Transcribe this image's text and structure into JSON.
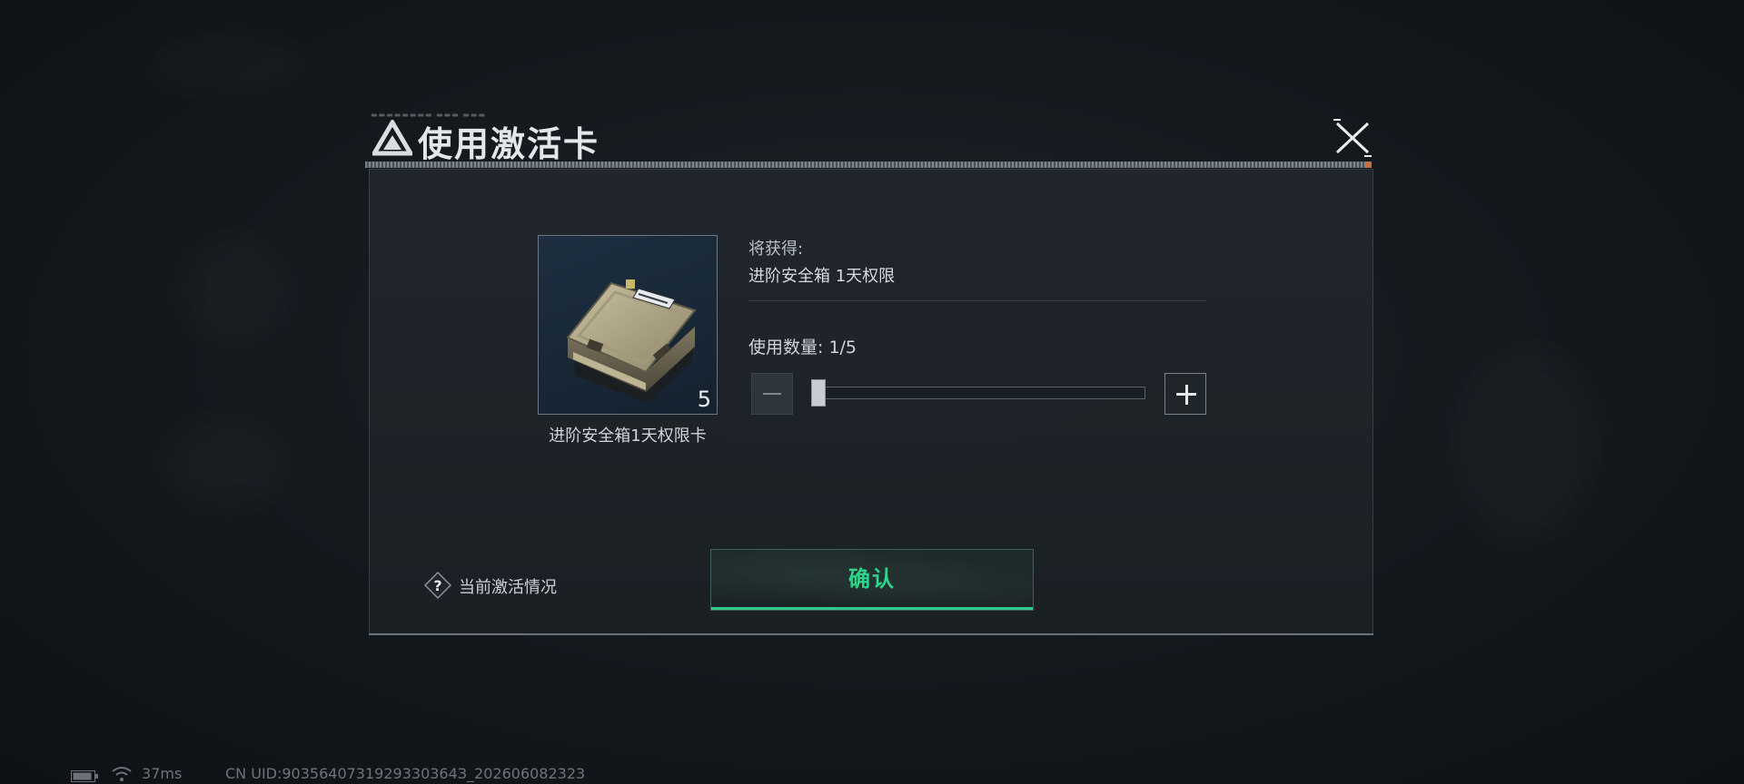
{
  "dialog": {
    "title": "使用激活卡",
    "title_micro": "▬▬▬▬▬▬▬▬ ▬▬▬ ▬▬▬"
  },
  "item": {
    "name": "进阶安全箱1天权限卡",
    "count": "5",
    "icon": "secure-case-icon"
  },
  "reward": {
    "label": "将获得:",
    "value": "进阶安全箱 1天权限"
  },
  "quantity": {
    "label": "使用数量: 1/5",
    "current": 1,
    "max": 5
  },
  "help": {
    "label": "当前激活情况",
    "icon": "question-icon"
  },
  "confirm": {
    "label": "确认"
  },
  "status_bar": {
    "ping": "37ms",
    "uid": "CN UID:9035640731929330364З_202606082323"
  },
  "colors": {
    "accent_green": "#2ed48c",
    "panel_bg": "#21272d"
  }
}
